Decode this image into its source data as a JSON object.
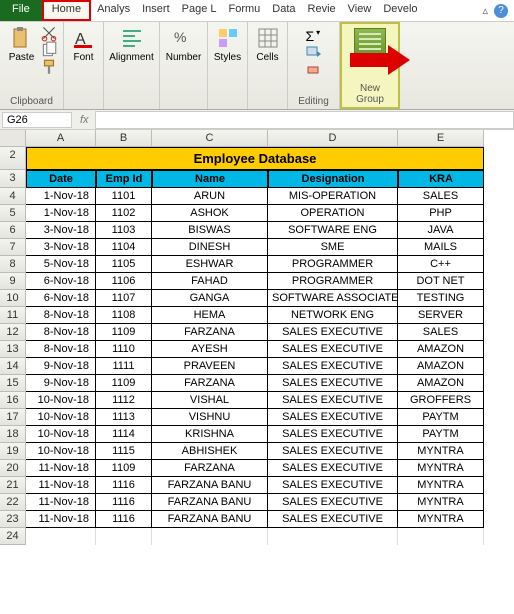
{
  "tabs": {
    "file": "File",
    "home": "Home",
    "others": [
      "Analys",
      "Insert",
      "Page L",
      "Formu",
      "Data",
      "Revie",
      "View",
      "Develo"
    ]
  },
  "ribbon": {
    "paste": "Paste",
    "font": "Font",
    "alignment": "Alignment",
    "number": "Number",
    "styles": "Styles",
    "cells": "Cells",
    "editing": "Editing",
    "form": "Form",
    "groups": {
      "clipboard": "Clipboard",
      "newgroup": "New Group"
    }
  },
  "namebox": "G26",
  "fx_label": "fx",
  "columns": [
    "A",
    "B",
    "C",
    "D",
    "E"
  ],
  "title": "Employee Database",
  "headers": [
    "Date",
    "Emp Id",
    "Name",
    "Designation",
    "KRA"
  ],
  "rows": [
    [
      "1-Nov-18",
      "1101",
      "ARUN",
      "MIS-OPERATION",
      "SALES"
    ],
    [
      "1-Nov-18",
      "1102",
      "ASHOK",
      "OPERATION",
      "PHP"
    ],
    [
      "3-Nov-18",
      "1103",
      "BISWAS",
      "SOFTWARE ENG",
      "JAVA"
    ],
    [
      "3-Nov-18",
      "1104",
      "DINESH",
      "SME",
      "MAILS"
    ],
    [
      "5-Nov-18",
      "1105",
      "ESHWAR",
      "PROGRAMMER",
      "C++"
    ],
    [
      "6-Nov-18",
      "1106",
      "FAHAD",
      "PROGRAMMER",
      "DOT NET"
    ],
    [
      "6-Nov-18",
      "1107",
      "GANGA",
      "SOFTWARE ASSOCIATE",
      "TESTING"
    ],
    [
      "8-Nov-18",
      "1108",
      "HEMA",
      "NETWORK ENG",
      "SERVER"
    ],
    [
      "8-Nov-18",
      "1109",
      "FARZANA",
      "SALES EXECUTIVE",
      "SALES"
    ],
    [
      "8-Nov-18",
      "1110",
      "AYESH",
      "SALES EXECUTIVE",
      "AMAZON"
    ],
    [
      "9-Nov-18",
      "1111",
      "PRAVEEN",
      "SALES EXECUTIVE",
      "AMAZON"
    ],
    [
      "9-Nov-18",
      "1109",
      "FARZANA",
      "SALES EXECUTIVE",
      "AMAZON"
    ],
    [
      "10-Nov-18",
      "1112",
      "VISHAL",
      "SALES EXECUTIVE",
      "GROFFERS"
    ],
    [
      "10-Nov-18",
      "1113",
      "VISHNU",
      "SALES EXECUTIVE",
      "PAYTM"
    ],
    [
      "10-Nov-18",
      "1114",
      "KRISHNA",
      "SALES EXECUTIVE",
      "PAYTM"
    ],
    [
      "10-Nov-18",
      "1115",
      "ABHISHEK",
      "SALES EXECUTIVE",
      "MYNTRA"
    ],
    [
      "11-Nov-18",
      "1109",
      "FARZANA",
      "SALES EXECUTIVE",
      "MYNTRA"
    ],
    [
      "11-Nov-18",
      "1116",
      "FARZANA BANU",
      "SALES EXECUTIVE",
      "MYNTRA"
    ],
    [
      "11-Nov-18",
      "1116",
      "FARZANA BANU",
      "SALES EXECUTIVE",
      "MYNTRA"
    ],
    [
      "11-Nov-18",
      "1116",
      "FARZANA BANU",
      "SALES EXECUTIVE",
      "MYNTRA"
    ]
  ],
  "row_start": 2
}
